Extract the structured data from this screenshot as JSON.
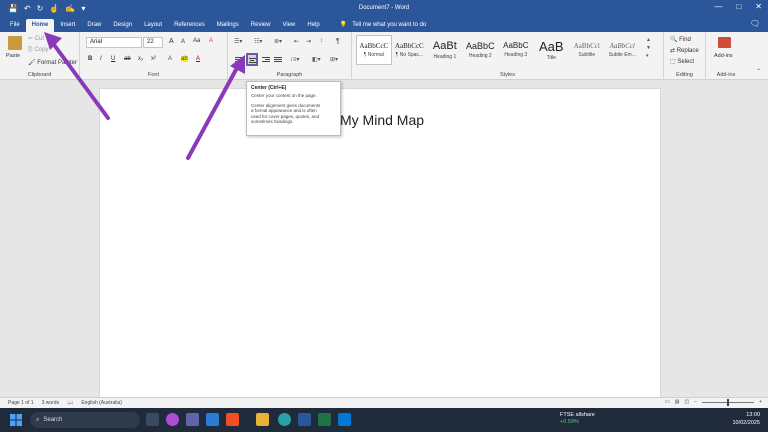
{
  "window": {
    "title": "Document7 - Word",
    "controls": [
      "—",
      "□",
      "✕"
    ]
  },
  "qat": {
    "icons": [
      "save-icon",
      "undo-icon",
      "redo-icon",
      "touch-mode-icon",
      "spelling-icon",
      "customize-icon"
    ],
    "glyphs": [
      "💾",
      "↶",
      "↻",
      "☝",
      "✍",
      "▾"
    ]
  },
  "tabs": [
    "File",
    "Home",
    "Insert",
    "Draw",
    "Design",
    "Layout",
    "References",
    "Mailings",
    "Review",
    "View",
    "Help"
  ],
  "active_tab": "Home",
  "tell_me": "Tell me what you want to do",
  "ribbon": {
    "clipboard": {
      "label": "Clipboard",
      "paste": "Paste",
      "cut": "Cut",
      "copy": "Copy",
      "format_painter": "Format Painter"
    },
    "font": {
      "label": "Font",
      "font_name": "Arial",
      "font_size": "22",
      "bold": "B",
      "italic": "I",
      "underline": "U",
      "strike": "ab",
      "sub": "x₂",
      "sup": "x²",
      "grow": "A",
      "shrink": "A",
      "case": "Aa",
      "clear": "A",
      "effects": "A",
      "highlight": "ab",
      "color": "A"
    },
    "paragraph": {
      "label": "Paragraph",
      "pilcrow": "¶"
    },
    "styles": {
      "label": "Styles",
      "items": [
        {
          "preview": "AaBbCcC",
          "name": "¶ Normal"
        },
        {
          "preview": "AaBbCcC",
          "name": "¶ No Spac..."
        },
        {
          "preview": "AaBt",
          "name": "Heading 1"
        },
        {
          "preview": "AaBbC",
          "name": "Heading 2"
        },
        {
          "preview": "AaBbC",
          "name": "Heading 3"
        },
        {
          "preview": "AaB",
          "name": "Title"
        },
        {
          "preview": "AaBbCcl",
          "name": "Subtitle"
        },
        {
          "preview": "AaBbCcl",
          "name": "Subtle Em..."
        }
      ]
    },
    "editing": {
      "label": "Editing",
      "find": "Find",
      "replace": "Replace",
      "select": "Select"
    },
    "addins": {
      "label": "Add-ins",
      "button": "Add-ins"
    }
  },
  "tooltip": {
    "title": "Center (Ctrl+E)",
    "line1": "Center your content on the page.",
    "body": [
      "Center alignment gives documents",
      "a formal appearance and is often",
      "used for cover pages, quotes, and",
      "sometimes headings."
    ]
  },
  "document": {
    "text": "My Mind Map"
  },
  "statusbar": {
    "page": "Page 1 of 1",
    "words": "3 words",
    "language": "English (Australia)",
    "zoom_fraction": 0.5
  },
  "taskbar": {
    "search": "Search",
    "ftse_name": "FTSE allshare",
    "ftse_change": "+0.59%",
    "time": "13:00",
    "date": "10/02/2025"
  },
  "colors": {
    "accent": "#2b579a",
    "annotation": "#8a3ab9",
    "highlight_box": "#6b5aa8"
  }
}
